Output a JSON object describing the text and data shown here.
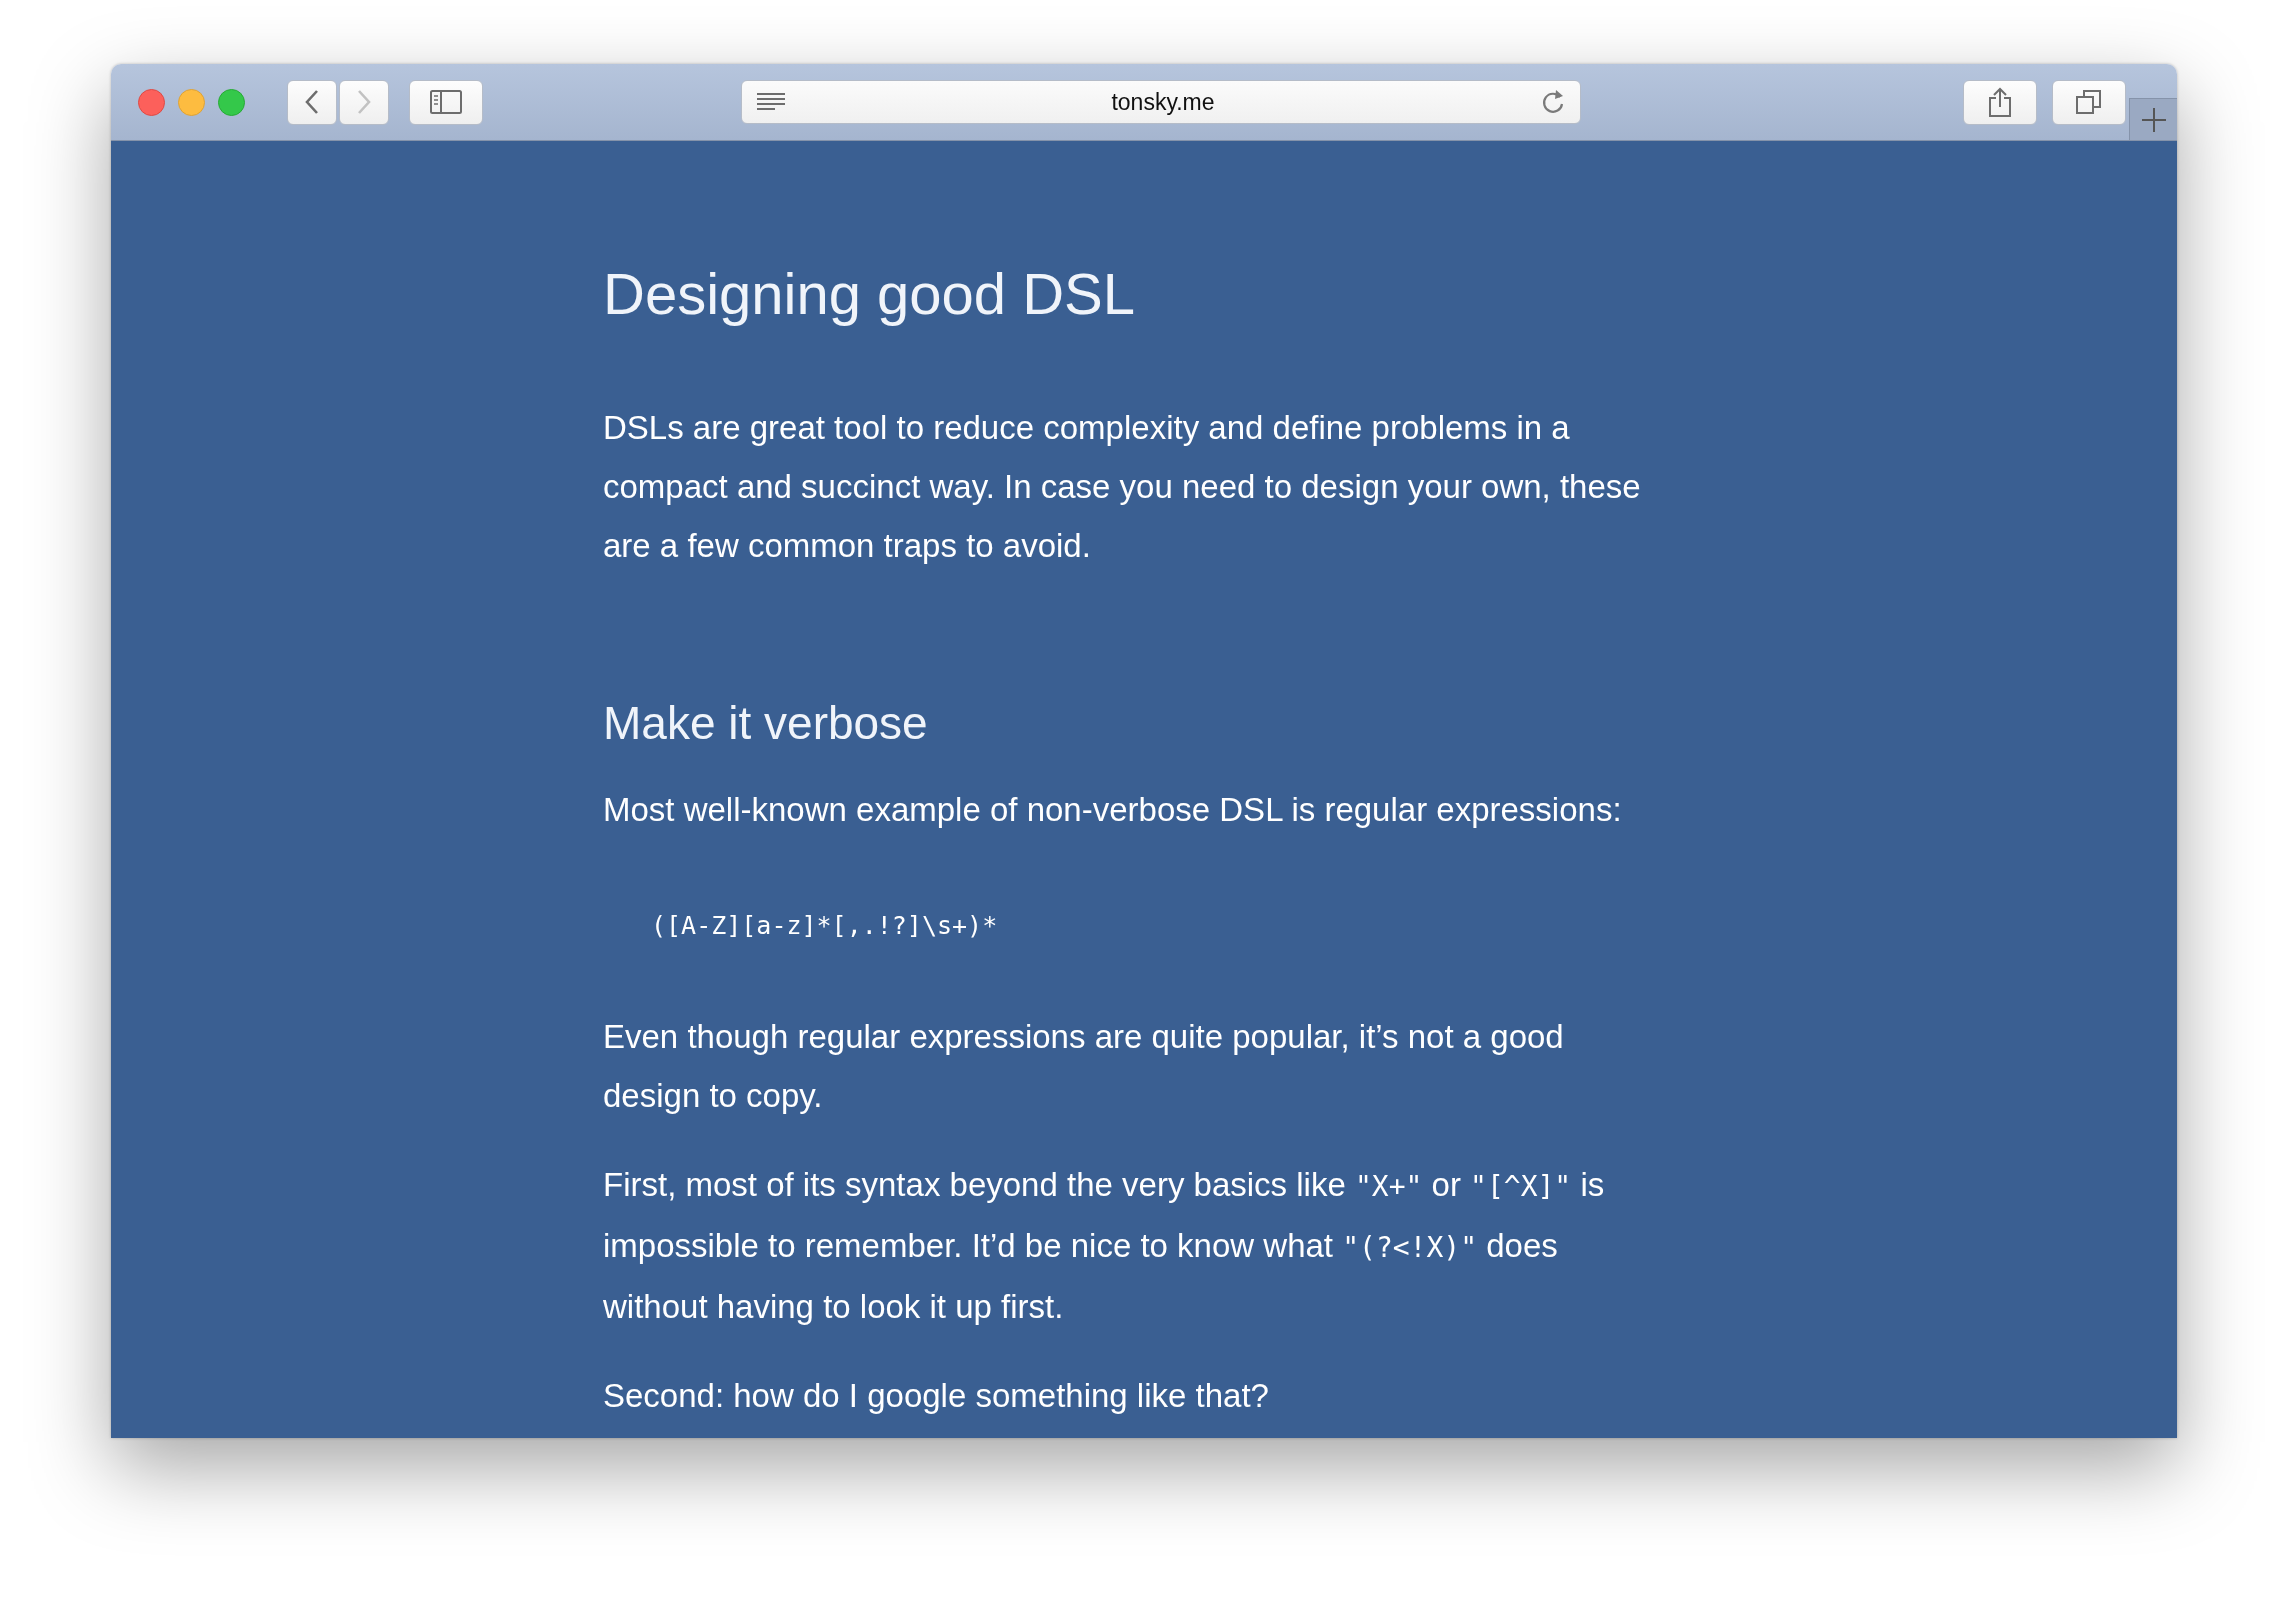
{
  "browser": {
    "url": "tonsky.me"
  },
  "article": [
    {
      "kind": "title",
      "text": "Designing good DSL"
    },
    {
      "kind": "intro",
      "segments": [
        {
          "kind": "text",
          "text": "DSLs are great tool to reduce complexity and define problems in a compact and succinct way. In case you need to design your own, these are a few common traps to avoid."
        }
      ]
    },
    {
      "kind": "heading",
      "text": "Make it verbose"
    },
    {
      "kind": "paragraph",
      "segments": [
        {
          "kind": "text",
          "text": "Most well-known example of non-verbose DSL is regular expressions:"
        }
      ]
    },
    {
      "kind": "code",
      "text": "([A-Z][a-z]*[,.!?]\\s+)*"
    },
    {
      "kind": "paragraph",
      "segments": [
        {
          "kind": "text",
          "text": "Even though regular expressions are quite popular, it’s not a good design to copy."
        }
      ]
    },
    {
      "kind": "paragraph",
      "segments": [
        {
          "kind": "text",
          "text": "First, most of its syntax beyond the very basics like "
        },
        {
          "kind": "code",
          "text": "\"X+\""
        },
        {
          "kind": "text",
          "text": " or "
        },
        {
          "kind": "code",
          "text": "\"[^X]\""
        },
        {
          "kind": "text",
          "text": " is impossible to remember. It’d be nice to know what "
        },
        {
          "kind": "code",
          "text": "\"(?<!X)\""
        },
        {
          "kind": "text",
          "text": " does without having to look it up first."
        }
      ]
    },
    {
      "kind": "paragraph",
      "segments": [
        {
          "kind": "text",
          "text": "Second: how do I google something like that?"
        }
      ]
    }
  ]
}
